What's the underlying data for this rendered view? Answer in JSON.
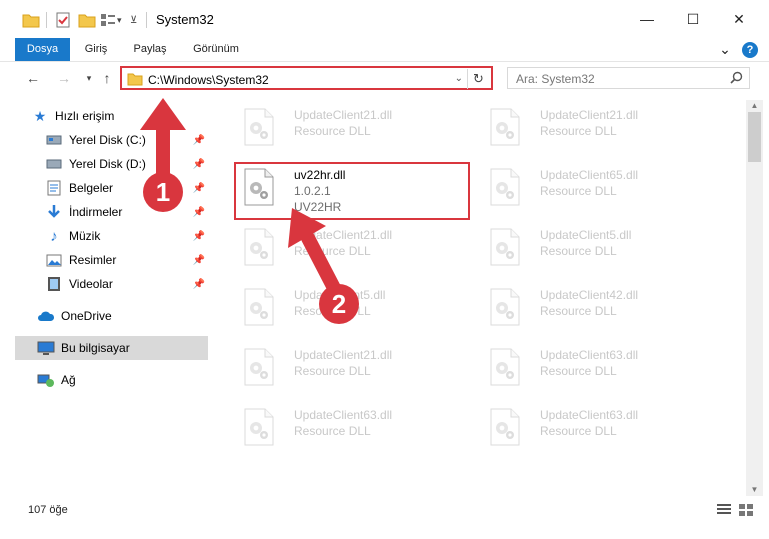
{
  "window": {
    "title": "System32",
    "minimize_glyph": "—",
    "maximize_glyph": "☐",
    "close_glyph": "✕"
  },
  "ribbon": {
    "tabs": [
      "Dosya",
      "Giriş",
      "Paylaş",
      "Görünüm"
    ],
    "collapse_glyph": "⌄",
    "help_glyph": "?"
  },
  "address": {
    "path": "C:\\Windows\\System32",
    "search_placeholder": "Ara: System32"
  },
  "nav": {
    "items": [
      {
        "label": "Hızlı erişim",
        "icon": "star-icon"
      },
      {
        "label": "Yerel Disk (C:)",
        "icon": "drive-icon",
        "pinned": true
      },
      {
        "label": "Yerel Disk (D:)",
        "icon": "drive-icon",
        "pinned": true
      },
      {
        "label": "Belgeler",
        "icon": "documents-icon",
        "pinned": true
      },
      {
        "label": "İndirmeler",
        "icon": "download-icon",
        "pinned": true
      },
      {
        "label": "Müzik",
        "icon": "music-icon",
        "pinned": true
      },
      {
        "label": "Resimler",
        "icon": "pictures-icon",
        "pinned": true
      },
      {
        "label": "Videolar",
        "icon": "video-icon",
        "pinned": true
      },
      {
        "label": "OneDrive",
        "icon": "cloud-icon"
      },
      {
        "label": "Bu bilgisayar",
        "icon": "computer-icon"
      },
      {
        "label": "Ağ",
        "icon": "network-icon"
      }
    ]
  },
  "files": {
    "left": [
      {
        "name": "UpdateClient21.dll",
        "desc": "Resource DLL"
      },
      {
        "name": "uv22hr.dll",
        "ver": "1.0.2.1",
        "desc": "UV22HR"
      },
      {
        "name": "UpdateClient21.dll",
        "desc": "Resource DLL"
      },
      {
        "name": "UpdateClient5.dll",
        "desc": "Resource DLL"
      },
      {
        "name": "UpdateClient21.dll",
        "desc": "Resource DLL"
      },
      {
        "name": "UpdateClient63.dll",
        "desc": "Resource DLL"
      }
    ],
    "right": [
      {
        "name": "UpdateClient21.dll",
        "desc": "Resource DLL"
      },
      {
        "name": "UpdateClient65.dll",
        "desc": "Resource DLL"
      },
      {
        "name": "UpdateClient5.dll",
        "desc": "Resource DLL"
      },
      {
        "name": "UpdateClient42.dll",
        "desc": "Resource DLL"
      },
      {
        "name": "UpdateClient63.dll",
        "desc": "Resource DLL"
      },
      {
        "name": "UpdateClient63.dll",
        "desc": "Resource DLL"
      }
    ]
  },
  "status": {
    "count": "107 öğe"
  },
  "annotations": {
    "badge1": "1",
    "badge2": "2",
    "color": "#d9363e"
  }
}
